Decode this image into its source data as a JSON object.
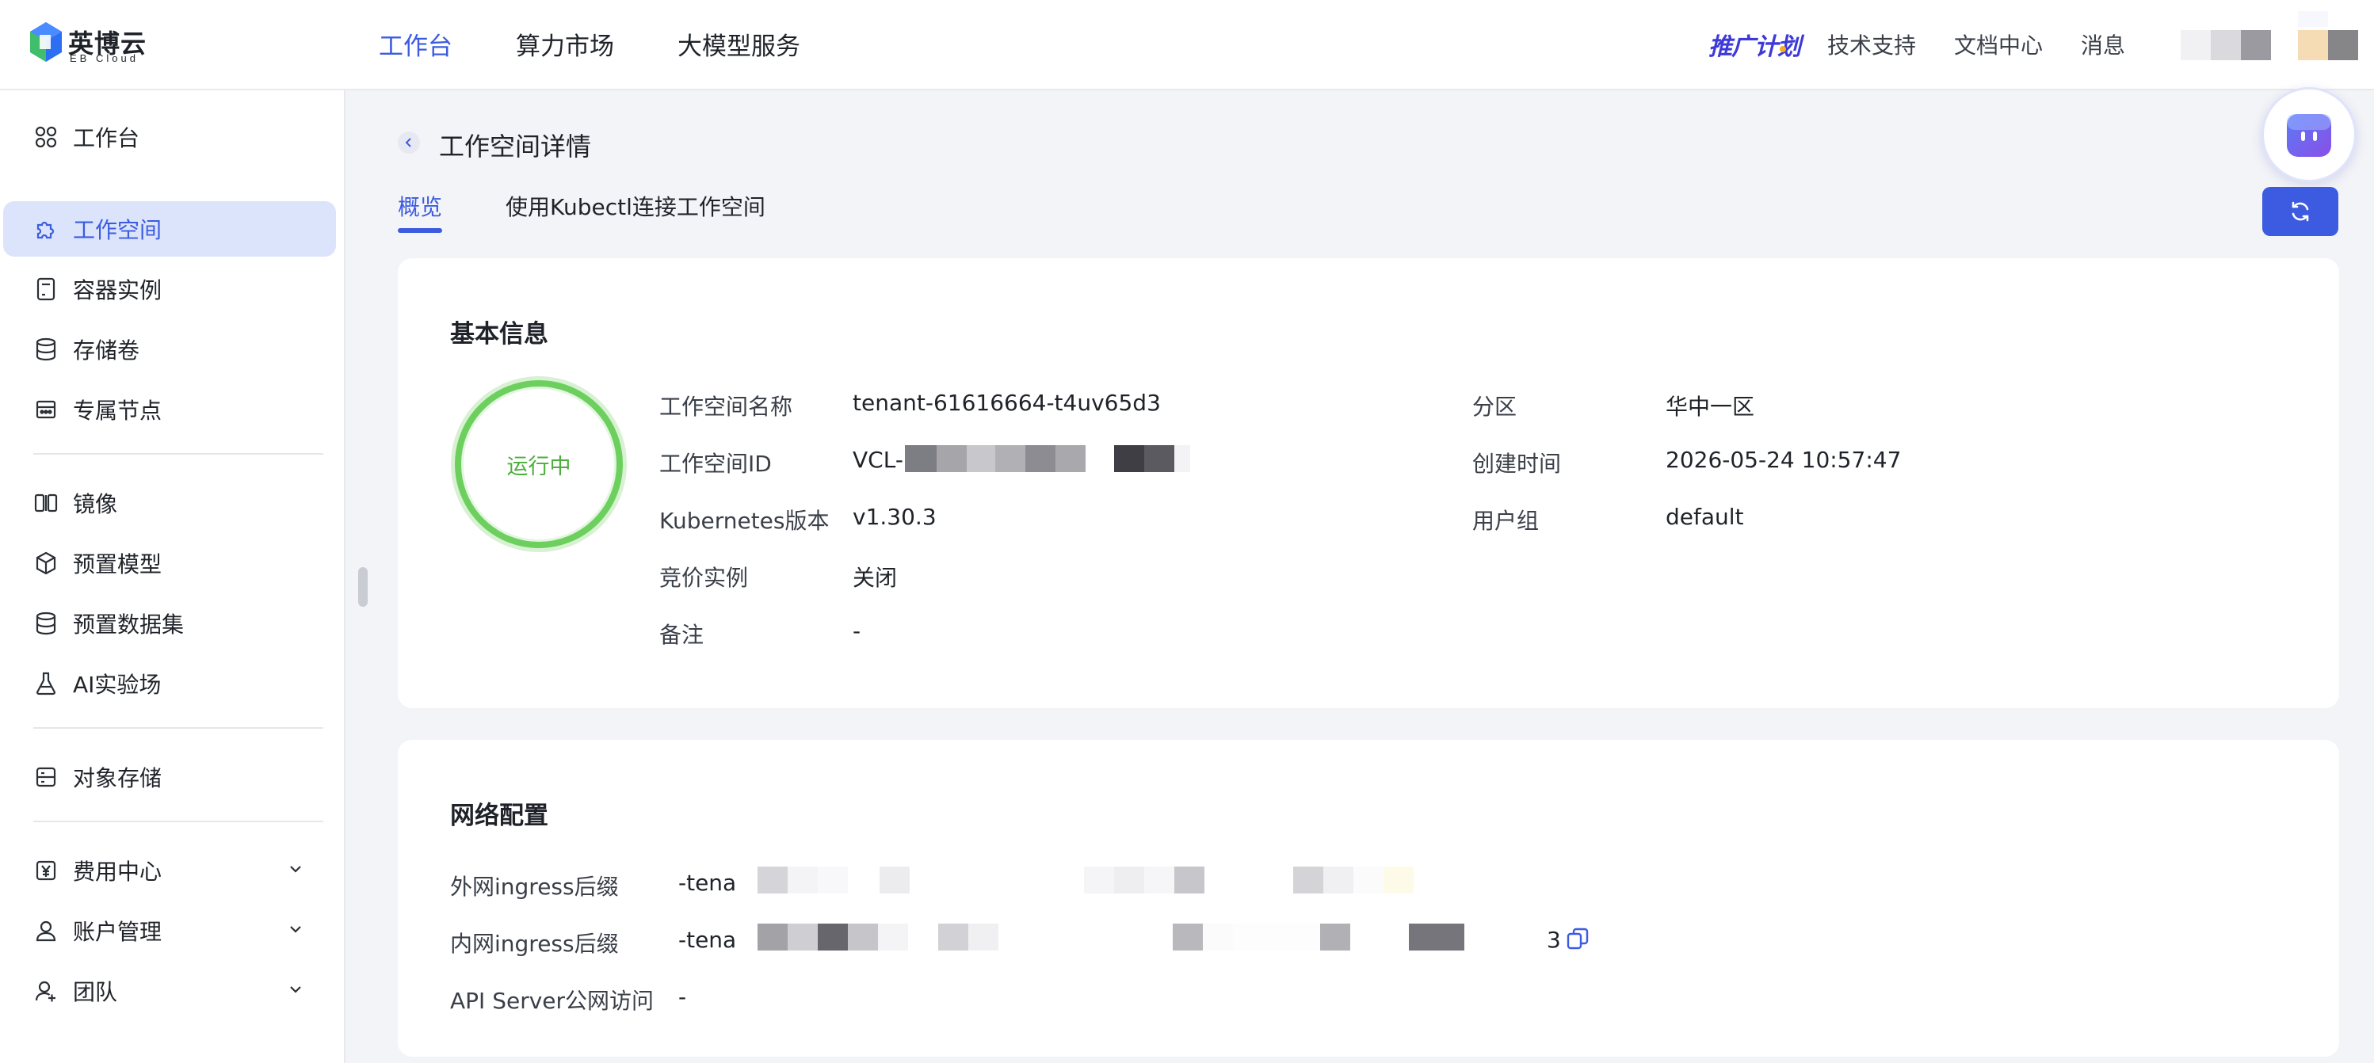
{
  "brand": {
    "name_cn": "英博云",
    "name_en": "EB Cloud",
    "accent": "#3c5be0"
  },
  "top_nav": [
    {
      "label": "工作台",
      "active": true
    },
    {
      "label": "算力市场",
      "active": false
    },
    {
      "label": "大模型服务",
      "active": false
    }
  ],
  "top_right": {
    "promo": "推广计划",
    "support": "技术支持",
    "docs": "文档中心",
    "messages": "消息"
  },
  "sidebar": {
    "items": [
      {
        "label": "工作台",
        "icon": "grid-icon"
      },
      {
        "label": "工作空间",
        "icon": "puzzle-icon",
        "active": true
      },
      {
        "label": "容器实例",
        "icon": "container-icon"
      },
      {
        "label": "存储卷",
        "icon": "database-icon"
      },
      {
        "label": "专属节点",
        "icon": "node-icon"
      },
      {
        "label": "镜像",
        "icon": "image-icon"
      },
      {
        "label": "预置模型",
        "icon": "cube-icon"
      },
      {
        "label": "预置数据集",
        "icon": "dataset-icon"
      },
      {
        "label": "AI实验场",
        "icon": "flask-icon"
      },
      {
        "label": "对象存储",
        "icon": "storage-icon"
      },
      {
        "label": "费用中心",
        "icon": "yen-icon",
        "expandable": true
      },
      {
        "label": "账户管理",
        "icon": "user-icon",
        "expandable": true
      },
      {
        "label": "团队",
        "icon": "team-icon",
        "expandable": true
      }
    ]
  },
  "page": {
    "title": "工作空间详情",
    "tabs": [
      {
        "label": "概览",
        "active": true
      },
      {
        "label": "使用Kubectl连接工作空间",
        "active": false
      }
    ]
  },
  "basic_info": {
    "title": "基本信息",
    "status": "运行中",
    "status_color": "#4cae3c",
    "left": [
      {
        "label": "工作空间名称",
        "value": "tenant-61616664-t4uv65d3"
      },
      {
        "label": "工作空间ID",
        "value": "VCL-"
      },
      {
        "label": "Kubernetes版本",
        "value": "v1.30.3"
      },
      {
        "label": "竞价实例",
        "value": "关闭"
      },
      {
        "label": "备注",
        "value": "-"
      }
    ],
    "right": [
      {
        "label": "分区",
        "value": "华中一区"
      },
      {
        "label": "创建时间",
        "value": "2026-05-24 10:57:47"
      },
      {
        "label": "用户组",
        "value": "default"
      }
    ]
  },
  "network": {
    "title": "网络配置",
    "rows": [
      {
        "label": "外网ingress后缀",
        "value": "-tena"
      },
      {
        "label": "内网ingress后缀",
        "value": "-tena",
        "tail": "3"
      },
      {
        "label": "API Server公网访问",
        "value": "-"
      }
    ]
  }
}
